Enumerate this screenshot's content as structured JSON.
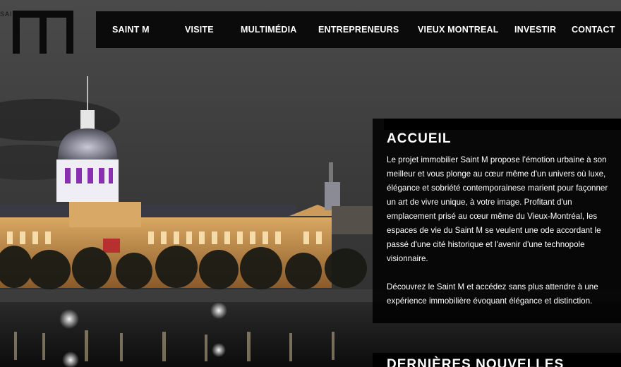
{
  "logo": {
    "word": "SAINT",
    "mark_letter": "M"
  },
  "nav": {
    "items": [
      {
        "label": "SAINT M"
      },
      {
        "label": "VISITE"
      },
      {
        "label": "MULTIMÉDIA"
      },
      {
        "label": "ENTREPRENEURS"
      },
      {
        "label": "VIEUX MONTREAL"
      },
      {
        "label": "INVESTIR"
      },
      {
        "label": "CONTACT"
      }
    ]
  },
  "main": {
    "heading": "ACCUEIL",
    "paragraphs": [
      "Le projet immobilier Saint M propose l'émotion urbaine à son meilleur et vous plonge au cœur même d'un univers où luxe, élégance et sobriété contemporainese marient pour façonner un art de vivre unique, à votre image. Profitant d'un emplacement prisé au cœur même du Vieux-Montréal, les espaces de vie du Saint M se veulent une ode accordant le passé d'une cité historique et l'avenir d'une technopole visionnaire.",
      "Découvrez le Saint M et accédez sans plus attendre à une expérience immobilière évoquant élégance et distinction."
    ]
  },
  "news": {
    "heading": "DERNIÈRES NOUVELLES"
  },
  "colors": {
    "nav_bg": "#0b0b0b",
    "panel_bg": "#000000",
    "text": "#ffffff",
    "sky": "#3a3a3a"
  },
  "background": {
    "subject": "night-view-bonsecours-market-old-montreal"
  }
}
